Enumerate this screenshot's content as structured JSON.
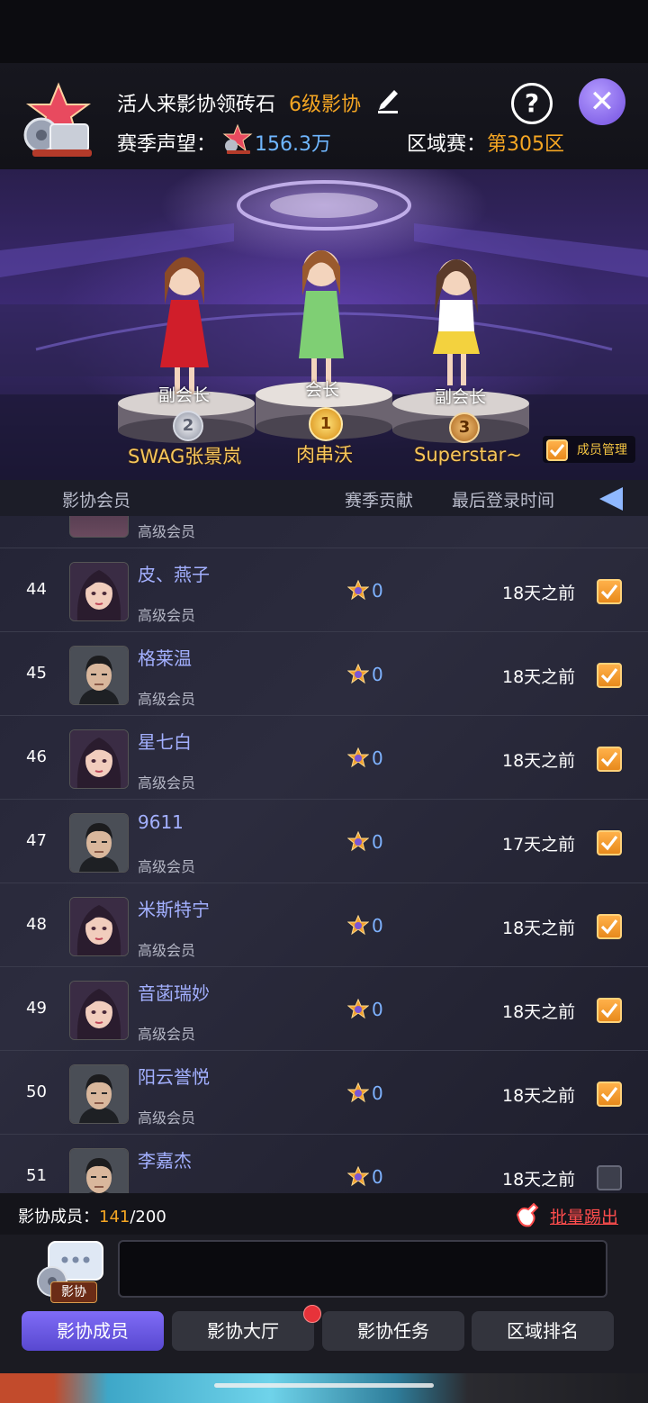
{
  "header": {
    "guild_name": "活人来影协领砖石",
    "guild_level": "6级影协",
    "season_prestige_label": "赛季声望：",
    "season_prestige_value": "156.3万",
    "region_label": "区域赛：",
    "region_value": "第305区",
    "help_symbol": "?",
    "close_symbol": "✕"
  },
  "podium": {
    "left": {
      "title": "副会长",
      "name": "SWAG张景岚",
      "medal": "2"
    },
    "center": {
      "title": "会长",
      "name": "肉串沃",
      "medal": "1"
    },
    "right": {
      "title": "副会长",
      "name": "Superstar~",
      "medal": "3"
    },
    "member_manage_label": "成员管理"
  },
  "columns": {
    "member": "影协会员",
    "contribution": "赛季贡献",
    "last_login": "最后登录时间"
  },
  "partial_top_role": "高级会员",
  "members": [
    {
      "rank": "44",
      "name": "皮、燕子",
      "role": "高级会员",
      "contribution": "0",
      "last_login": "18天之前",
      "checked": true,
      "avatar": "female"
    },
    {
      "rank": "45",
      "name": "格莱温",
      "role": "高级会员",
      "contribution": "0",
      "last_login": "18天之前",
      "checked": true,
      "avatar": "male"
    },
    {
      "rank": "46",
      "name": "星七白",
      "role": "高级会员",
      "contribution": "0",
      "last_login": "18天之前",
      "checked": true,
      "avatar": "female"
    },
    {
      "rank": "47",
      "name": "9611",
      "role": "高级会员",
      "contribution": "0",
      "last_login": "17天之前",
      "checked": true,
      "avatar": "male"
    },
    {
      "rank": "48",
      "name": "米斯特宁",
      "role": "高级会员",
      "contribution": "0",
      "last_login": "18天之前",
      "checked": true,
      "avatar": "female"
    },
    {
      "rank": "49",
      "name": "音菡瑞妙",
      "role": "高级会员",
      "contribution": "0",
      "last_login": "18天之前",
      "checked": true,
      "avatar": "female"
    },
    {
      "rank": "50",
      "name": "阳云誉悦",
      "role": "高级会员",
      "contribution": "0",
      "last_login": "18天之前",
      "checked": true,
      "avatar": "male"
    },
    {
      "rank": "51",
      "name": "李嘉杰",
      "role": "高级会员",
      "contribution": "0",
      "last_login": "18天之前",
      "checked": false,
      "avatar": "male"
    }
  ],
  "footer": {
    "member_count_label": "影协成员：",
    "member_count_current": "141",
    "member_count_max": "/200",
    "batch_kick": "批量踢出"
  },
  "chat": {
    "badge": "影协",
    "input_value": ""
  },
  "tabs": [
    {
      "label": "影协成员",
      "active": true
    },
    {
      "label": "影协大厅",
      "active": false,
      "notification": true
    },
    {
      "label": "影协任务",
      "active": false
    },
    {
      "label": "区域排名",
      "active": false
    }
  ],
  "colors": {
    "accent_orange": "#f5a623",
    "accent_blue": "#6fb6ff",
    "name_purple": "#a3b0ff",
    "tab_active": "#6a5ae6",
    "kick_red": "#ff4d4d"
  }
}
